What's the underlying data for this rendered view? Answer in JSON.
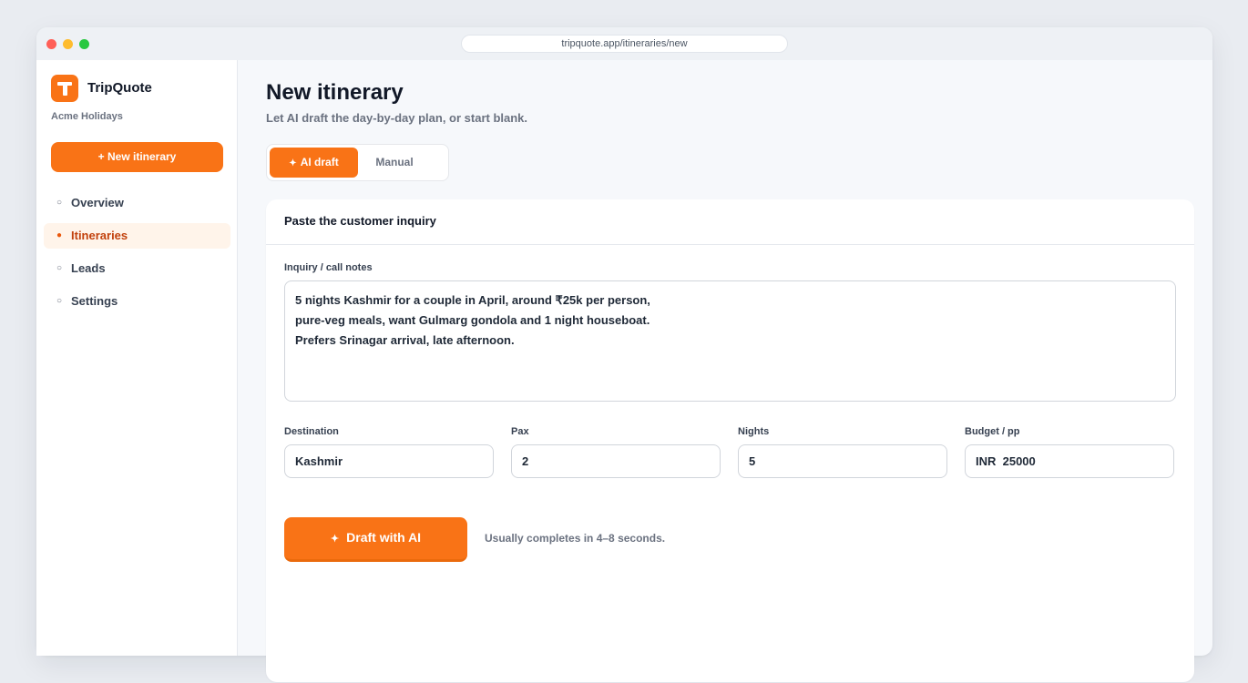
{
  "browser": {
    "url": "tripquote.app/itineraries/new"
  },
  "sidebar": {
    "brand": "TripQuote",
    "workspace": "Acme Holidays",
    "new_button": "+ New itinerary",
    "items": [
      {
        "label": "Overview",
        "active": false
      },
      {
        "label": "Itineraries",
        "active": true
      },
      {
        "label": "Leads",
        "active": false
      },
      {
        "label": "Settings",
        "active": false
      }
    ]
  },
  "main": {
    "title": "New itinerary",
    "subtitle": "Let AI draft the day-by-day plan, or start blank.",
    "tabs": [
      {
        "label": "AI draft",
        "active": true,
        "icon": "sparkle-icon"
      },
      {
        "label": "Manual",
        "active": false
      }
    ],
    "card": {
      "title": "Paste the customer inquiry",
      "inquiry_label": "Inquiry / call notes",
      "inquiry_lines": [
        "5 nights Kashmir for a couple in April, around ₹25k per person,",
        "pure-veg meals, want Gulmarg gondola and 1 night houseboat.",
        "Prefers Srinagar arrival, late afternoon."
      ],
      "fields": {
        "destination": {
          "label": "Destination",
          "value": "Kashmir"
        },
        "pax": {
          "label": "Pax",
          "value": "2"
        },
        "nights": {
          "label": "Nights",
          "value": "5"
        },
        "budget": {
          "label": "Budget / pp",
          "value": "INR  25000"
        }
      },
      "draft_button": "Draft with AI",
      "hint": "Usually completes in 4–8 seconds."
    }
  },
  "colors": {
    "accent": "#f97316",
    "active_nav_bg": "#fff4ea",
    "active_nav_text": "#c2410c"
  }
}
